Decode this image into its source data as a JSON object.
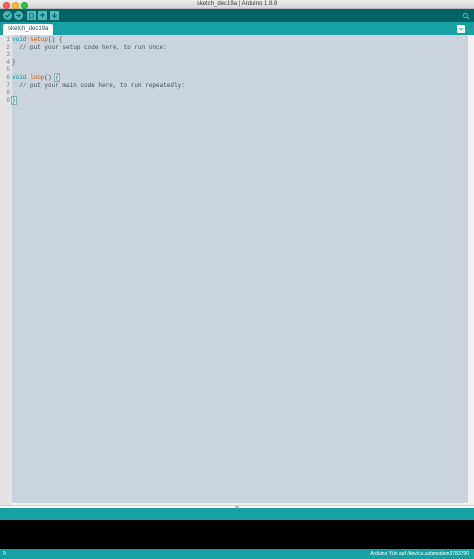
{
  "window": {
    "title": "sketch_dec19a | Arduino 1.8.8"
  },
  "toolbar": {
    "buttons": [
      {
        "name": "verify",
        "icon": "checkmark-icon"
      },
      {
        "name": "upload",
        "icon": "arrow-right-icon"
      },
      {
        "name": "new",
        "icon": "new-file-icon"
      },
      {
        "name": "open",
        "icon": "arrow-up-icon"
      },
      {
        "name": "save",
        "icon": "arrow-down-icon"
      }
    ],
    "serial_monitor_icon": "magnifier-icon"
  },
  "tabs": [
    {
      "label": "sketch_dec19a",
      "active": true
    }
  ],
  "editor": {
    "lines": [
      {
        "number": "1",
        "text": "void setup() {"
      },
      {
        "number": "2",
        "text": "  // put your setup code here, to run once:"
      },
      {
        "number": "3",
        "text": ""
      },
      {
        "number": "4",
        "text": "}"
      },
      {
        "number": "5",
        "text": ""
      },
      {
        "number": "6",
        "text": "void loop() {"
      },
      {
        "number": "7",
        "text": "  // put your main code here, to run repeatedly:"
      },
      {
        "number": "8",
        "text": ""
      },
      {
        "number": "9",
        "text": "}"
      }
    ],
    "tokens": {
      "void": "void",
      "setup": "setup",
      "loop": "loop",
      "parens": "()",
      "brace_open": "{",
      "brace_close": "}",
      "comment_setup": "// put your setup code here, to run once:",
      "comment_loop": "// put your main code here, to run repeatedly:"
    }
  },
  "status": {
    "line_number": "9",
    "board": "Arduino Yún auf /dev/cu.usbmodem3783790"
  },
  "colors": {
    "toolbar_bg": "#006468",
    "tabbar_bg": "#17a1a5",
    "button_bg": "#4db7bb",
    "editor_bg": "#cbd3dd",
    "keyword": "#00979c",
    "function": "#d35400",
    "console_bg": "#000000"
  }
}
